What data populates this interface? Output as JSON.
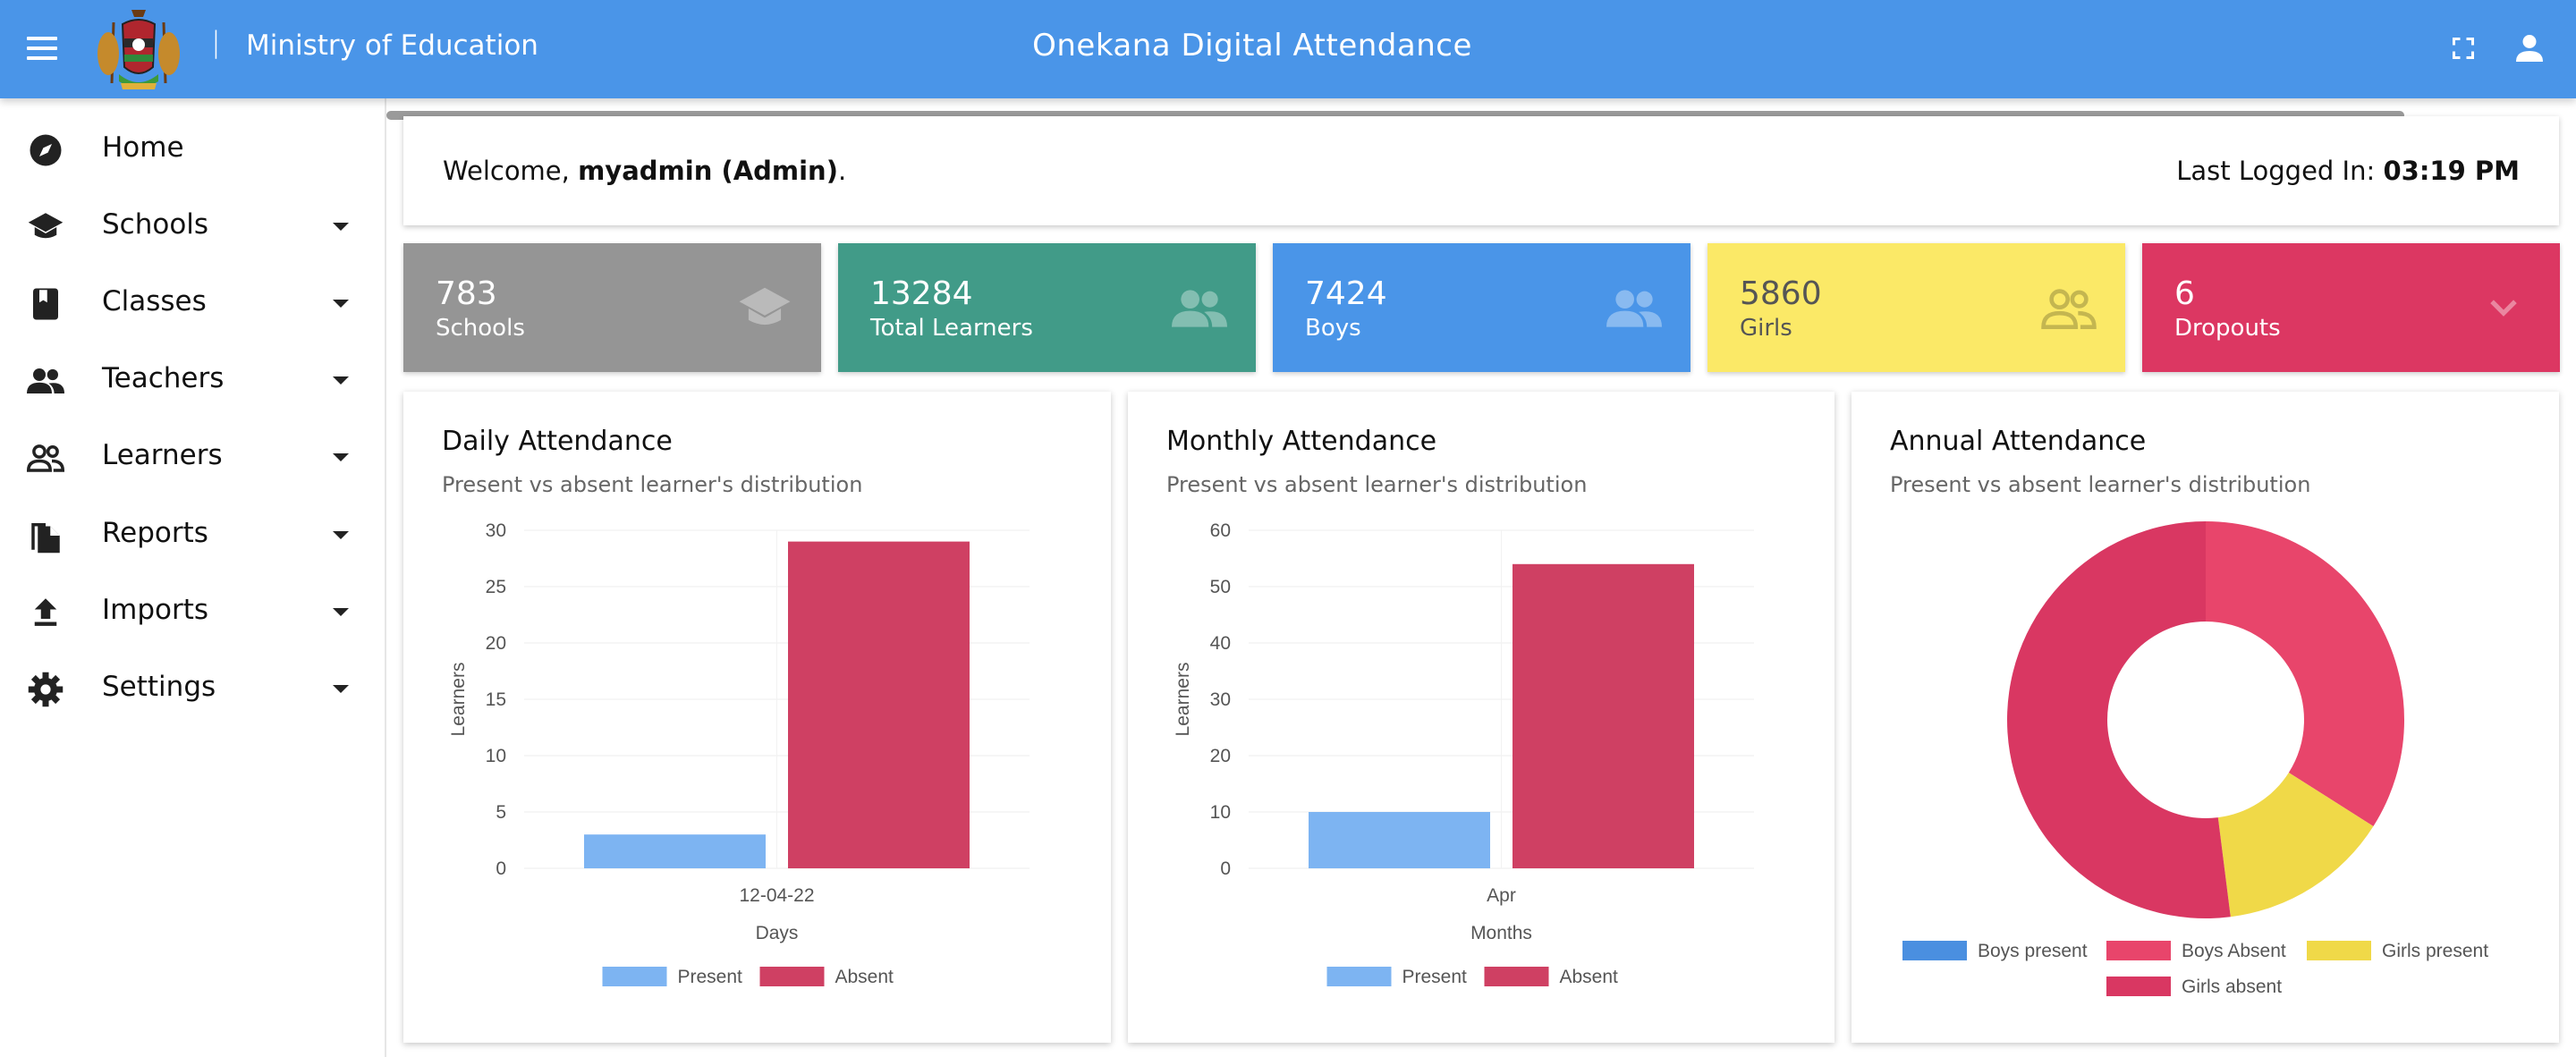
{
  "header": {
    "ministry": "Ministry of Education",
    "separator": "|",
    "app_title": "Onekana Digital Attendance"
  },
  "sidebar": {
    "items": [
      {
        "label": "Home",
        "icon": "compass-icon",
        "has_caret": false
      },
      {
        "label": "Schools",
        "icon": "school-icon",
        "has_caret": true
      },
      {
        "label": "Classes",
        "icon": "book-icon",
        "has_caret": true
      },
      {
        "label": "Teachers",
        "icon": "people-icon",
        "has_caret": true
      },
      {
        "label": "Learners",
        "icon": "people-outline-icon",
        "has_caret": true
      },
      {
        "label": "Reports",
        "icon": "documents-icon",
        "has_caret": true
      },
      {
        "label": "Imports",
        "icon": "upload-icon",
        "has_caret": true
      },
      {
        "label": "Settings",
        "icon": "gear-icon",
        "has_caret": true
      }
    ]
  },
  "welcome": {
    "prefix": "Welcome, ",
    "user": "myadmin (Admin)",
    "suffix": ".",
    "last_logged_label": "Last Logged In: ",
    "last_logged_time": "03:19 PM"
  },
  "stats": [
    {
      "value": "783",
      "label": "Schools",
      "color": "#959595",
      "icon": "school-icon"
    },
    {
      "value": "13284",
      "label": "Total Learners",
      "color": "#419b88",
      "icon": "people-icon"
    },
    {
      "value": "7424",
      "label": "Boys",
      "color": "#4a95e8",
      "icon": "people-icon"
    },
    {
      "value": "5860",
      "label": "Girls",
      "color": "#fbe967",
      "icon": "people-outline-icon"
    },
    {
      "value": "6",
      "label": "Dropouts",
      "color": "#dc3762",
      "icon": "chevron-down-icon"
    }
  ],
  "cards": {
    "daily": {
      "title": "Daily Attendance",
      "subtitle": "Present vs absent learner's distribution"
    },
    "monthly": {
      "title": "Monthly Attendance",
      "subtitle": "Present vs absent learner's distribution"
    },
    "annual": {
      "title": "Annual Attendance",
      "subtitle": "Present vs absent learner's distribution"
    }
  },
  "chart_data": [
    {
      "type": "bar",
      "categories": [
        "12-04-22"
      ],
      "series": [
        {
          "name": "Present",
          "values": [
            3
          ],
          "color": "#7db4f2"
        },
        {
          "name": "Absent",
          "values": [
            29
          ],
          "color": "#cf4063"
        }
      ],
      "xlabel": "Days",
      "ylabel": "Learners",
      "ylim": [
        0,
        30
      ],
      "yticks": [
        0,
        5,
        10,
        15,
        20,
        25,
        30
      ],
      "legend": "bottom",
      "grid": true
    },
    {
      "type": "bar",
      "categories": [
        "Apr"
      ],
      "series": [
        {
          "name": "Present",
          "values": [
            10
          ],
          "color": "#7db4f2"
        },
        {
          "name": "Absent",
          "values": [
            54
          ],
          "color": "#cf4063"
        }
      ],
      "xlabel": "Months",
      "ylabel": "Learners",
      "ylim": [
        0,
        60
      ],
      "yticks": [
        0,
        10,
        20,
        30,
        40,
        50,
        60
      ],
      "legend": "bottom",
      "grid": true
    },
    {
      "type": "pie",
      "donut": true,
      "slices": [
        {
          "name": "Boys present",
          "value": 0,
          "color": "#4a8fe0"
        },
        {
          "name": "Boys Absent",
          "value": 34,
          "color": "#e8456b"
        },
        {
          "name": "Girls present",
          "value": 14,
          "color": "#f0d948"
        },
        {
          "name": "Girls absent",
          "value": 52,
          "color": "#d93762"
        }
      ],
      "legend": "bottom"
    }
  ]
}
